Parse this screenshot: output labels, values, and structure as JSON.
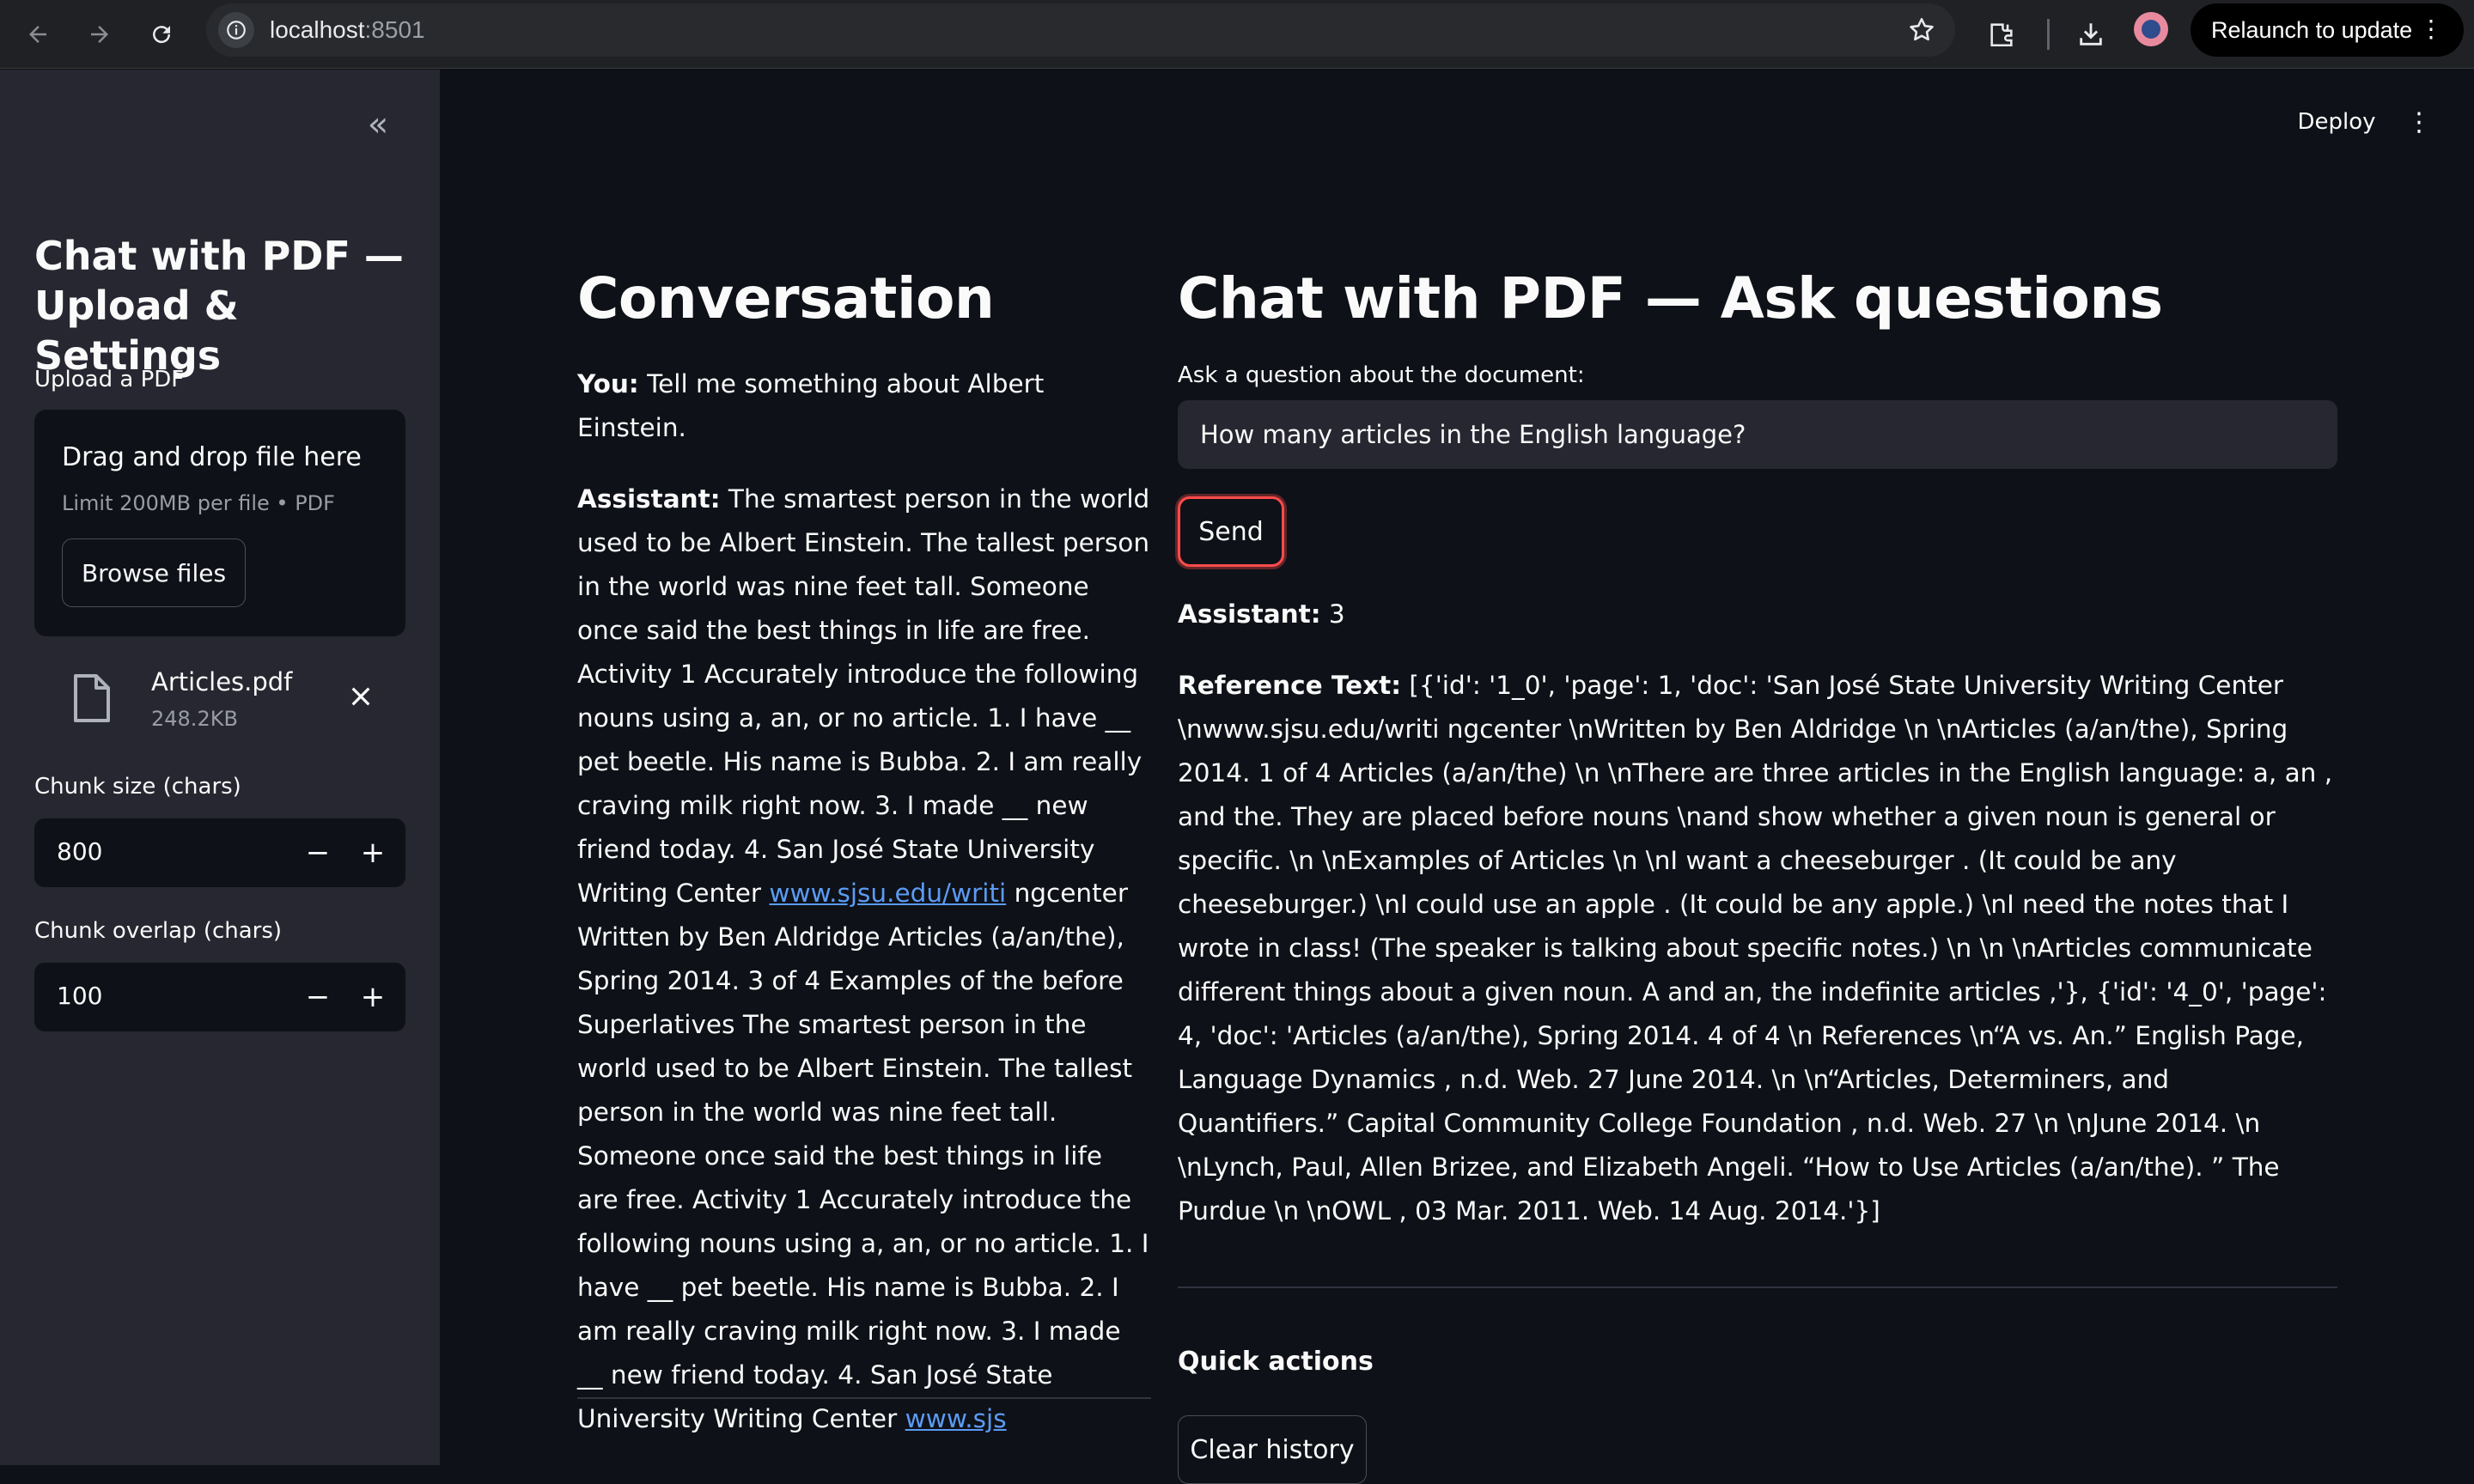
{
  "browser": {
    "url_host": "localhost",
    "url_port": ":8501",
    "relaunch_label": "Relaunch to update"
  },
  "sidebar": {
    "title": "Chat with PDF — Upload & Settings",
    "upload_label": "Upload a PDF",
    "dropzone_title": "Drag and drop file here",
    "dropzone_limit": "Limit 200MB per file • PDF",
    "browse_label": "Browse files",
    "file_name": "Articles.pdf",
    "file_size": "248.2KB",
    "chunk_size_label": "Chunk size (chars)",
    "chunk_size_value": "800",
    "chunk_overlap_label": "Chunk overlap (chars)",
    "chunk_overlap_value": "100"
  },
  "header": {
    "deploy_label": "Deploy"
  },
  "conversation": {
    "heading": "Conversation",
    "user_label": "You:",
    "user_text": "Tell me something about Albert Einstein.",
    "assistant_label": "Assistant:",
    "assistant_text_1": "The smartest person in the world used to be Albert Einstein. The tallest person in the world was nine feet tall. Someone once said the best things in life are free. Activity 1 Accurately introduce the following nouns using a, an, or no article. 1. I have __ pet beetle. His name is Bubba. 2. I am really craving milk right now. 3. I made __ new friend today. 4. San José State University Writing Center",
    "assistant_link_1": "www.sjsu.edu/writi",
    "assistant_text_2": "ngcenter Written by Ben Aldridge Articles (a/an/the), Spring 2014. 3 of 4 Examples of the before Superlatives The smartest person in the world used to be Albert Einstein. The tallest person in the world was nine feet tall. Someone once said the best things in life are free. Activity 1 Accurately introduce the following nouns using a, an, or no article. 1. I have __ pet beetle. His name is Bubba. 2. I am really craving milk right now. 3. I made __ new friend today. 4. San José State University Writing Center",
    "assistant_link_2": "www.sjs"
  },
  "chat": {
    "heading": "Chat with PDF — Ask questions",
    "question_label": "Ask a question about the document:",
    "question_value": "How many articles in the English language?",
    "send_label": "Send",
    "answer_label": "Assistant:",
    "answer_value": "3",
    "reference_label": "Reference Text:",
    "reference_text": "[{'id': '1_0', 'page': 1, 'doc': 'San José State University Writing Center \\nwww.sjsu.edu/writi ngcenter \\nWritten by Ben Aldridge \\n \\nArticles (a/an/the), Spring 2014. 1 of 4 Articles (a/an/the) \\n \\nThere are three articles in the English language: a, an , and the. They are placed before nouns \\nand show whether a given noun is general or specific. \\n \\nExamples of Articles \\n \\nI want a cheeseburger . (It could be any cheeseburger.) \\nI could use an apple . (It could be any apple.) \\nI need the notes that I wrote in class! (The speaker is talking about specific notes.) \\n \\n \\nArticles communicate different things about a given noun. A and an, the indefinite articles ,'}, {'id': '4_0', 'page': 4, 'doc': 'Articles (a/an/the), Spring 2014. 4 of 4 \\n References \\n“A vs. An.” English Page, Language Dynamics , n.d. Web. 27 June 2014. \\n \\n“Articles, Determiners, and Quantifiers.” Capital Community College Foundation , n.d. Web. 27 \\n \\nJune 2014. \\n \\nLynch, Paul, Allen Brizee, and Elizabeth Angeli. “How to Use Articles (a/an/the). ” The Purdue \\n \\nOWL , 03 Mar. 2011. Web. 14 Aug. 2014.'}]",
    "quick_actions_label": "Quick actions",
    "clear_history_label": "Clear history"
  }
}
